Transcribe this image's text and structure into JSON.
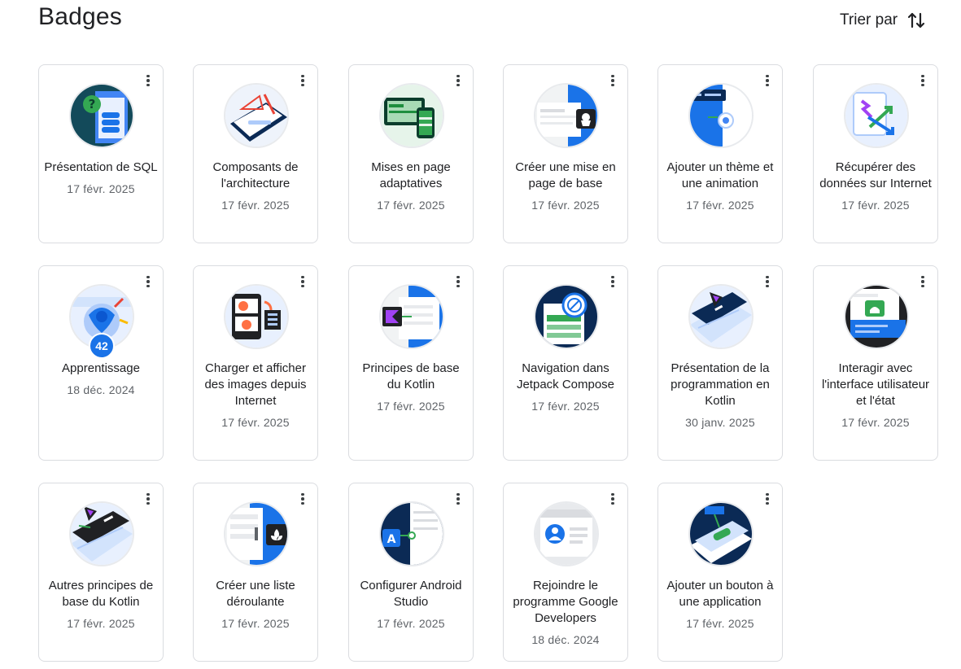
{
  "header": {
    "title": "Badges",
    "sort_label": "Trier par"
  },
  "badges": [
    {
      "name": "Présentation de SQL",
      "date": "17 févr. 2025",
      "icon": "sql-database-icon"
    },
    {
      "name": "Composants de l'architecture",
      "date": "17 févr. 2025",
      "icon": "architecture-blueprint-icon"
    },
    {
      "name": "Mises en page adaptatives",
      "date": "17 févr. 2025",
      "icon": "adaptive-layout-icon"
    },
    {
      "name": "Créer une mise en page de base",
      "date": "17 févr. 2025",
      "icon": "cupcake-layout-icon"
    },
    {
      "name": "Ajouter un thème et une animation",
      "date": "17 févr. 2025",
      "icon": "theme-animation-icon"
    },
    {
      "name": "Récupérer des données sur Internet",
      "date": "17 févr. 2025",
      "icon": "internet-data-icon"
    },
    {
      "name": "Apprentissage",
      "date": "18 déc. 2024",
      "icon": "learning-icon",
      "count": "42"
    },
    {
      "name": "Charger et afficher des images depuis Internet",
      "date": "17 févr. 2025",
      "icon": "load-images-icon"
    },
    {
      "name": "Principes de base du Kotlin",
      "date": "17 févr. 2025",
      "icon": "kotlin-basics-icon"
    },
    {
      "name": "Navigation dans Jetpack Compose",
      "date": "17 févr. 2025",
      "icon": "compose-navigation-icon"
    },
    {
      "name": "Présentation de la programmation en Kotlin",
      "date": "30 janv. 2025",
      "icon": "kotlin-intro-icon"
    },
    {
      "name": "Interagir avec l'interface utilisateur et l'état",
      "date": "17 févr. 2025",
      "icon": "ui-state-icon"
    },
    {
      "name": "Autres principes de base du Kotlin",
      "date": "17 févr. 2025",
      "icon": "kotlin-more-icon"
    },
    {
      "name": "Créer une liste déroulante",
      "date": "17 févr. 2025",
      "icon": "scrollable-list-icon"
    },
    {
      "name": "Configurer Android Studio",
      "date": "17 févr. 2025",
      "icon": "android-studio-icon"
    },
    {
      "name": "Rejoindre le programme Google Developers",
      "date": "18 déc. 2024",
      "icon": "developer-profile-icon"
    },
    {
      "name": "Ajouter un bouton à une application",
      "date": "17 févr. 2025",
      "icon": "add-button-icon"
    }
  ]
}
